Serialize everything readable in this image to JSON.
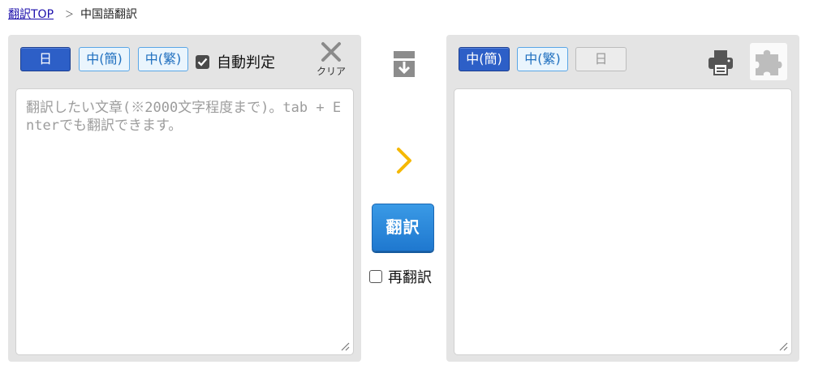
{
  "breadcrumb": {
    "home": "翻訳TOP",
    "separator": "＞",
    "current": "中国語翻訳"
  },
  "source": {
    "langs": [
      "日",
      "中(簡)",
      "中(繁)"
    ],
    "auto_detect": "自動判定",
    "clear": "クリア",
    "placeholder": "翻訳したい文章(※2000文字程度まで)。tab + Enterでも翻訳できます。"
  },
  "target": {
    "langs": [
      "中(簡)",
      "中(繁)",
      "日"
    ]
  },
  "controls": {
    "translate": "翻訳",
    "retranslate": "再翻訳"
  },
  "colors": {
    "accent": "#2d5fc7",
    "translate_button": "#2a8ae0",
    "arrow": "#f5b800",
    "panel": "#e4e4e4"
  },
  "icons": [
    "swap-direction-icon",
    "arrow-right-icon",
    "print-icon",
    "puzzle-icon",
    "clear-x-icon",
    "checkmark-icon",
    "resize-grip-icon"
  ]
}
